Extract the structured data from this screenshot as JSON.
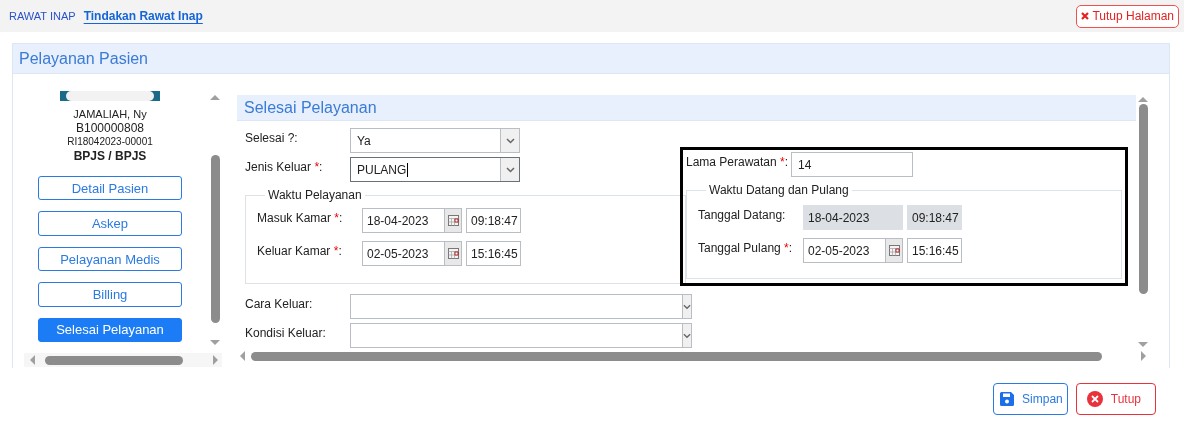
{
  "breadcrumb": [
    {
      "label": "RAWAT INAP",
      "kind": "plain"
    },
    {
      "label": "Tindakan Rawat Inap",
      "kind": "link"
    }
  ],
  "close_page_button": {
    "label": "Tutup Halaman"
  },
  "panel": {
    "title": "Pelayanan Pasien"
  },
  "patient": {
    "name": "JAMALIAH, Ny",
    "record_number": "B100000808",
    "visit_number": "RI18042023-00001",
    "payer": "BPJS / BPJS"
  },
  "nav": [
    {
      "label": "Detail Pasien",
      "selected": false
    },
    {
      "label": "Askep",
      "selected": false
    },
    {
      "label": "Pelayanan Medis",
      "selected": false
    },
    {
      "label": "Billing",
      "selected": false
    },
    {
      "label": "Selesai Pelayanan",
      "selected": true
    }
  ],
  "form": {
    "title": "Selesai Pelayanan",
    "fields": [
      {
        "label": "Selesai ?:",
        "value": "Ya",
        "focused": false
      },
      {
        "label": "Jenis Keluar ",
        "required_mark": "*",
        "suffix": ":",
        "value": "PULANG",
        "focused": true
      }
    ],
    "service_time": {
      "legend": "Waktu Pelayanan",
      "rows": [
        {
          "label": "Masuk Kamar ",
          "required_mark": "*",
          "suffix": ":",
          "date": "18-04-2023",
          "time": "09:18:47",
          "disabled": false
        },
        {
          "label": "Keluar Kamar ",
          "required_mark": "*",
          "suffix": ":",
          "date": "02-05-2023",
          "time": "15:16:45",
          "disabled": false
        }
      ]
    },
    "lower_fields": [
      {
        "label": "Cara Keluar:"
      },
      {
        "label": "Kondisi Keluar:"
      }
    ],
    "summary": {
      "highlighted": true,
      "stay": {
        "label": "Lama Perawatan ",
        "required_mark": "*",
        "suffix": ":",
        "value": "14"
      },
      "legend": "Waktu Datang dan Pulang",
      "rows": [
        {
          "label": "Tanggal Datang:",
          "date": "18-04-2023",
          "time": "09:18:47",
          "disabled": true
        },
        {
          "label": "Tanggal Pulang ",
          "required_mark": "*",
          "suffix": ":",
          "date": "02-05-2023",
          "time": "15:16:45",
          "disabled": false
        }
      ]
    }
  },
  "actions": [
    {
      "label": "Simpan",
      "kind": "save"
    },
    {
      "label": "Tutup",
      "kind": "close"
    }
  ]
}
